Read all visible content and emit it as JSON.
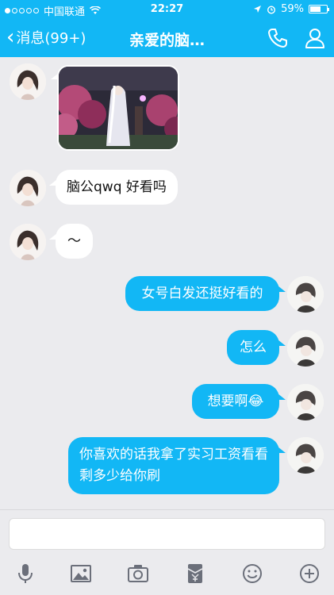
{
  "status": {
    "carrier": "中国联通",
    "time": "22:27",
    "battery": "59%"
  },
  "nav": {
    "back_label": "消息(99+)",
    "title": "亲爱的脑…"
  },
  "messages": [
    {
      "side": "left",
      "type": "image"
    },
    {
      "side": "left",
      "text": "脑公qwq 好看吗"
    },
    {
      "side": "left",
      "text": "～"
    },
    {
      "side": "right",
      "text": "女号白发还挺好看的"
    },
    {
      "side": "right",
      "text": "怎么"
    },
    {
      "side": "right",
      "text": "想要啊😂"
    },
    {
      "side": "right",
      "text": "你喜欢的话我拿了实习工资看看剩多少给你刷"
    }
  ],
  "toolbar": {
    "icons": [
      "microphone-icon",
      "image-icon",
      "camera-icon",
      "red-packet-icon",
      "emoji-icon",
      "plus-icon"
    ]
  },
  "colors": {
    "accent": "#12b7f5",
    "background": "#ebebee"
  }
}
